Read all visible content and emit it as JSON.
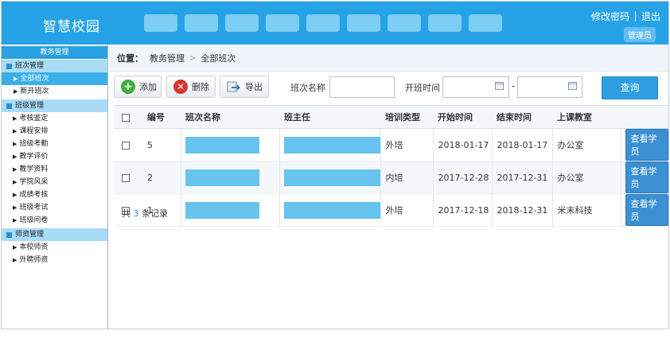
{
  "header": {
    "brand": "智慧校园",
    "change_password": "修改密码",
    "logout": "退出",
    "role": "管理员"
  },
  "sidebar": {
    "title": "教务管理",
    "groups": [
      {
        "label": "班次管理",
        "items": [
          "全部班次",
          "新开班次"
        ]
      },
      {
        "label": "班级管理",
        "items": [
          "考核鉴定",
          "课程安排",
          "班级考勤",
          "教学评价",
          "教学资料",
          "学院风采",
          "成绩考核",
          "班级考试",
          "班级问卷"
        ]
      },
      {
        "label": "师资管理",
        "items": [
          "本校师资",
          "外聘师资"
        ]
      }
    ]
  },
  "breadcrumb": {
    "label": "位置：",
    "parent": "教务管理",
    "current": "全部班次"
  },
  "toolbar": {
    "add": "添加",
    "delete": "删除",
    "export": "导出",
    "class_name_label": "班次名称",
    "class_name_value": "",
    "start_time_label": "开班时间",
    "start_from": "",
    "start_to": "",
    "dash": "-",
    "search": "查询"
  },
  "table": {
    "headers": [
      "编号",
      "班次名称",
      "班主任",
      "培训类型",
      "开始时间",
      "结束时间",
      "上课教室"
    ],
    "rows": [
      {
        "id": "5",
        "type": "外培",
        "start": "2018-01-17",
        "end": "2018-01-17",
        "room": "办公室",
        "action": "查看学员"
      },
      {
        "id": "2",
        "type": "内培",
        "start": "2017-12-28",
        "end": "2017-12-31",
        "room": "办公室",
        "action": "查看学员"
      },
      {
        "id": "1",
        "type": "外培",
        "start": "2017-12-18",
        "end": "2018-12-31",
        "room": "米末科技",
        "action": "查看学员"
      }
    ]
  },
  "footer": {
    "prefix": "共",
    "count": "3",
    "suffix": "条记录"
  },
  "colors": {
    "header": "#26a3e6",
    "accent": "#2f9fe2",
    "sidebar_group": "#a8dcf6",
    "redacted": "#66c4ee"
  }
}
